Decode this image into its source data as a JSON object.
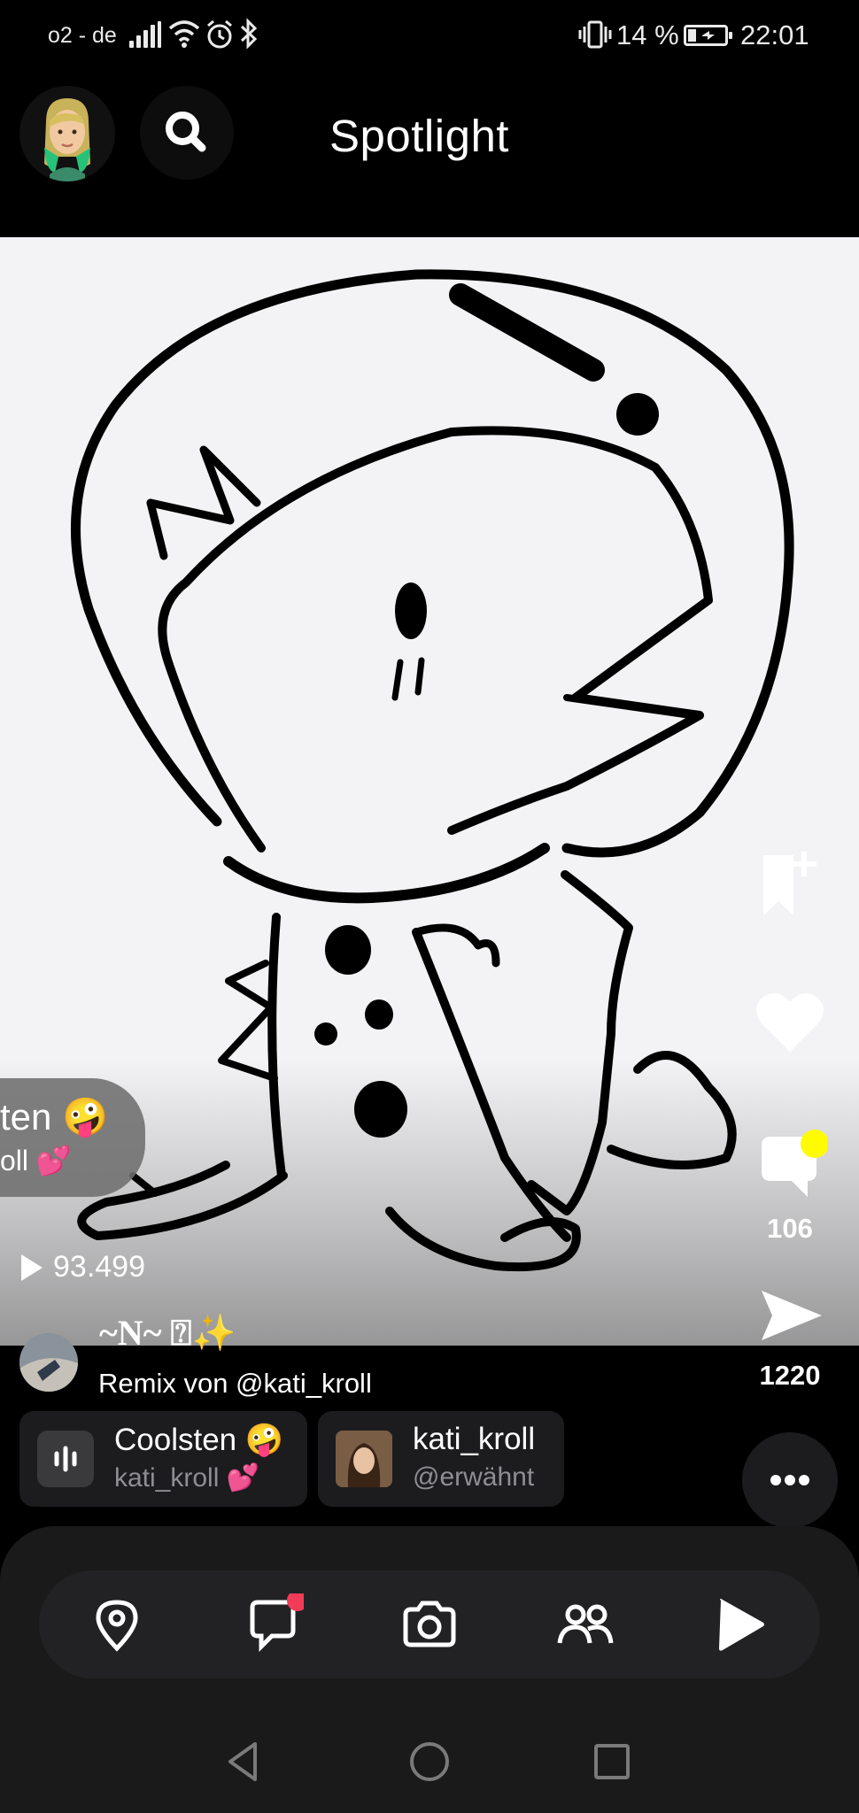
{
  "status_bar": {
    "carrier": "o2 - de",
    "battery_percent": "14 %",
    "time": "22:01",
    "icons": [
      "signal-icon",
      "wifi-icon",
      "alarm-icon",
      "bluetooth-icon",
      "vibrate-icon",
      "battery-charging-icon"
    ]
  },
  "header": {
    "title": "Spotlight",
    "avatar_icon": "bitmoji-avatar",
    "search_icon": "search-icon"
  },
  "video": {
    "description": "line drawing of a dinosaur in an astronaut helmet",
    "sticker": {
      "line1": "ten 🤪",
      "line2": "oll 💕"
    },
    "views": "93.499"
  },
  "actions": {
    "bookmark_icon": "bookmark-add-icon",
    "like_icon": "heart-icon",
    "comment_icon": "comment-icon",
    "comment_count": "106",
    "share_icon": "share-icon",
    "share_count": "1220",
    "more_icon": "more-dots-icon"
  },
  "creator": {
    "name": "~N~ ⍰✨",
    "remix_text": "Remix von @kati_kroll"
  },
  "chips": {
    "sound": {
      "title": "Coolsten 🤪",
      "subtitle": "kati_kroll 💕",
      "icon": "sound-wave-icon"
    },
    "mention": {
      "title": "kati_kroll",
      "subtitle": "@erwähnt"
    }
  },
  "nav": {
    "items": [
      "map-pin-icon",
      "chat-icon",
      "camera-icon",
      "friends-icon",
      "play-icon"
    ],
    "chat_has_badge": true,
    "badge_color": "#f23c57"
  },
  "system_nav": [
    "back-icon",
    "home-icon",
    "recents-icon"
  ],
  "colors": {
    "notification_yellow": "#fffc00",
    "badge_red": "#f23c57"
  }
}
